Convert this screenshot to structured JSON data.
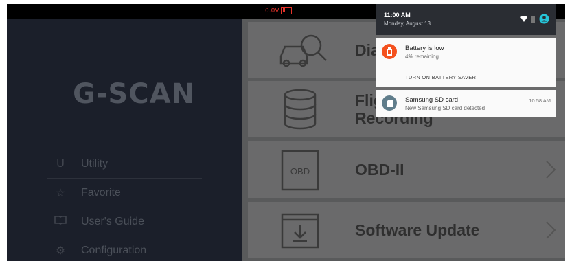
{
  "status_bar": {
    "voltage": "0.0V",
    "battery_icon": "battery-icon"
  },
  "sidebar": {
    "logo": "G-SCAN",
    "items": [
      {
        "label": "Utility",
        "icon": "utility-icon"
      },
      {
        "label": "Favorite",
        "icon": "star-icon"
      },
      {
        "label": "User's Guide",
        "icon": "book-icon"
      },
      {
        "label": "Configuration",
        "icon": "gear-icon"
      }
    ]
  },
  "menu": {
    "tiles": [
      {
        "label": "Diag",
        "icon": "car-diagnosis-icon"
      },
      {
        "label_line1": "Flig",
        "label_line2": "Recording",
        "icon": "database-icon"
      },
      {
        "label": "OBD-II",
        "icon": "obd-icon",
        "icon_text": "OBD"
      },
      {
        "label": "Software Update",
        "icon": "download-icon"
      }
    ]
  },
  "notification_shade": {
    "time": "11:00 AM",
    "date": "Monday, August 13",
    "notifications": [
      {
        "title": "Battery is low",
        "subtitle": "4% remaining",
        "action": "TURN ON BATTERY SAVER",
        "icon": "battery-alert-icon",
        "icon_color": "#f4511e"
      },
      {
        "title": "Samsung SD card",
        "subtitle": "New Samsung SD card detected",
        "time": "10:58 AM",
        "icon": "sd-card-icon",
        "icon_color": "#607d8b"
      }
    ]
  },
  "colors": {
    "accent": "#26c6da"
  }
}
